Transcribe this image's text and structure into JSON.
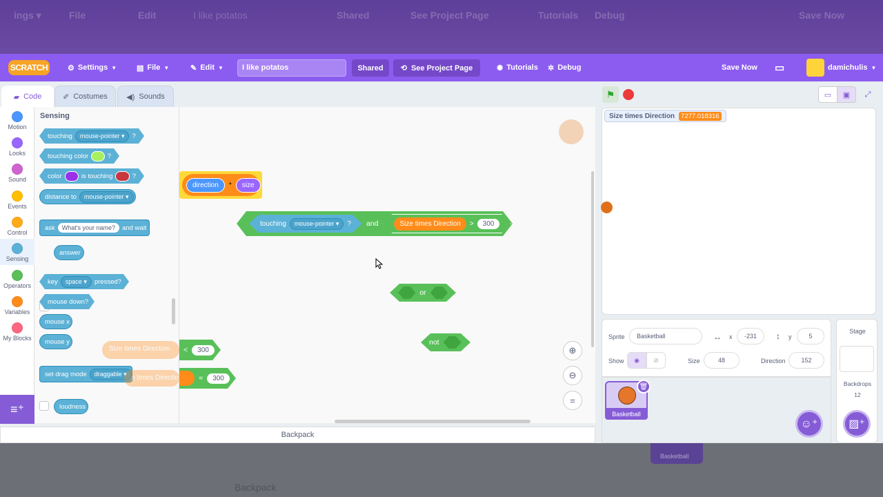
{
  "menubar": {
    "logo": "SCRATCH",
    "settings": "Settings",
    "file": "File",
    "edit": "Edit",
    "project_title": "I like potatos",
    "shared": "Shared",
    "see_project_page": "See Project Page",
    "tutorials": "Tutorials",
    "debug": "Debug",
    "save_now": "Save Now",
    "username": "damichulis"
  },
  "ghost_menubar": {
    "file": "File",
    "edit": "Edit",
    "title": "I like potatos",
    "shared": "Shared",
    "see_project_page": "See Project Page",
    "tutorials": "Tutorials",
    "debug": "Debug",
    "save_now": "Save Now",
    "backpack": "Backpack",
    "basketball": "Basketball"
  },
  "tabs": {
    "code": "Code",
    "costumes": "Costumes",
    "sounds": "Sounds"
  },
  "categories": [
    {
      "label": "Motion",
      "color": "#4c97ff"
    },
    {
      "label": "Looks",
      "color": "#9966ff"
    },
    {
      "label": "Sound",
      "color": "#cf63cf"
    },
    {
      "label": "Events",
      "color": "#ffbf00"
    },
    {
      "label": "Control",
      "color": "#ffab19"
    },
    {
      "label": "Sensing",
      "color": "#5cb1d6"
    },
    {
      "label": "Operators",
      "color": "#59c059"
    },
    {
      "label": "Variables",
      "color": "#ff8c1a"
    },
    {
      "label": "My Blocks",
      "color": "#ff6680"
    }
  ],
  "palette": {
    "heading": "Sensing",
    "touching": "touching",
    "mouse_pointer": "mouse-pointer",
    "q": "?",
    "touching_color": "touching color",
    "color": "color",
    "is_touching": "is touching",
    "distance_to": "distance to",
    "ask": "ask",
    "ask_default": "What's your name?",
    "and_wait": "and wait",
    "answer": "answer",
    "key": "key",
    "space": "space",
    "pressed": "pressed?",
    "mouse_down": "mouse down?",
    "mouse_x": "mouse x",
    "mouse_y": "mouse y",
    "set_drag_mode": "set drag mode",
    "draggable": "draggable",
    "loudness": "loudness"
  },
  "workspace": {
    "direction": "direction",
    "times": "*",
    "size": "size",
    "touching": "touching",
    "mouse_pointer": "mouse-pointer",
    "q": "?",
    "and": "and",
    "var_name": "Size times Direction",
    "gt": ">",
    "gt_value": "300",
    "or": "or",
    "not": "not",
    "lt": "<",
    "lt_value": "300",
    "eq": "=",
    "eq_value": "300",
    "ghost_lt_label": "Size times Direction",
    "ghost_eq_label": "n times Direction"
  },
  "backpack": "Backpack",
  "stage": {
    "monitor_label": "Size times Direction",
    "monitor_value": "7277.018316"
  },
  "sprite_info": {
    "sprite_label": "Sprite",
    "sprite_name": "Basketball",
    "x_label": "x",
    "x_value": "-231",
    "y_label": "y",
    "y_value": "5",
    "show_label": "Show",
    "size_label": "Size",
    "size_value": "48",
    "direction_label": "Direction",
    "direction_value": "152"
  },
  "sprites": [
    {
      "name": "Basketball"
    }
  ],
  "stage_panel": {
    "title": "Stage",
    "backdrops_label": "Backdrops",
    "backdrops_count": "12"
  },
  "colors": {
    "accent": "#855cd6",
    "menubar": "#8c5cf0",
    "sensing": "#5cb1d6",
    "operators": "#59c059",
    "variables": "#ff8c1a"
  }
}
